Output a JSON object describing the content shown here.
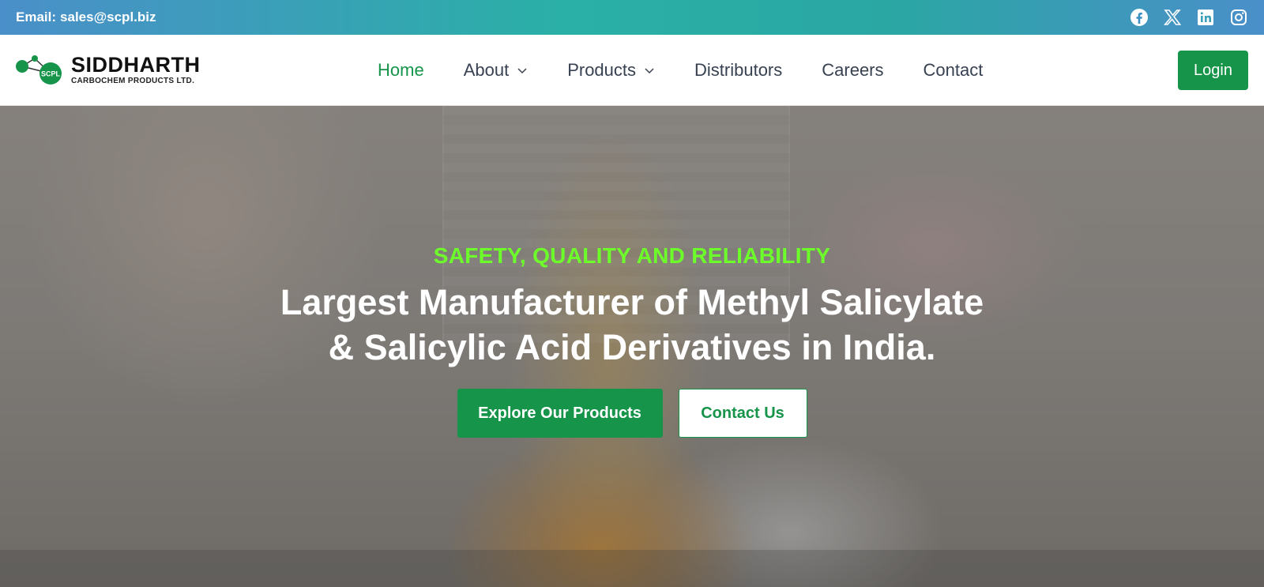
{
  "topbar": {
    "email_label": "Email:",
    "email_value": "sales@scpl.biz",
    "social": [
      "facebook-icon",
      "x-icon",
      "linkedin-icon",
      "instagram-icon"
    ]
  },
  "header": {
    "logo": {
      "name": "SIDDHARTH",
      "subtitle": "CARBOCHEM PRODUCTS LTD.",
      "badge": "SCPL"
    },
    "nav": [
      {
        "label": "Home",
        "active": true,
        "dropdown": false
      },
      {
        "label": "About",
        "active": false,
        "dropdown": true
      },
      {
        "label": "Products",
        "active": false,
        "dropdown": true
      },
      {
        "label": "Distributors",
        "active": false,
        "dropdown": false
      },
      {
        "label": "Careers",
        "active": false,
        "dropdown": false
      },
      {
        "label": "Contact",
        "active": false,
        "dropdown": false
      }
    ],
    "login_label": "Login"
  },
  "hero": {
    "tagline": "SAFETY, QUALITY AND RELIABILITY",
    "headline_line1": "Largest Manufacturer of Methyl Salicylate",
    "headline_line2": "& Salicylic Acid Derivatives in India.",
    "primary_button": "Explore Our Products",
    "secondary_button": "Contact Us"
  },
  "colors": {
    "brand_green": "#16944a",
    "tagline_green": "#6dff2a",
    "nav_text": "#374151"
  }
}
